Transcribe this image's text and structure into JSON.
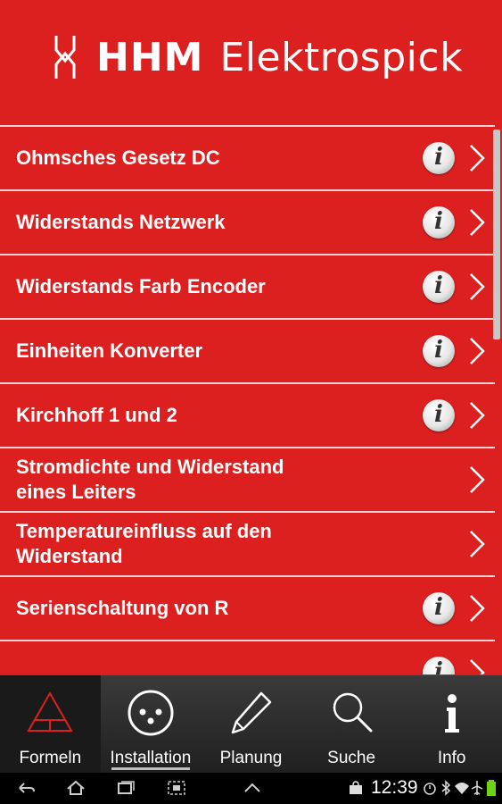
{
  "header": {
    "brand": "HHM",
    "app_name": "Elektrospick"
  },
  "list": {
    "items": [
      {
        "label": "Ohmsches Gesetz DC",
        "has_info": true
      },
      {
        "label": "Widerstands Netzwerk",
        "has_info": true
      },
      {
        "label": "Widerstands Farb Encoder",
        "has_info": true
      },
      {
        "label": "Einheiten Konverter",
        "has_info": true
      },
      {
        "label": "Kirchhoff 1 und 2",
        "has_info": true
      },
      {
        "label": "Stromdichte und Widerstand\neines Leiters",
        "has_info": false
      },
      {
        "label": "Temperatureinfluss auf den\nWiderstand",
        "has_info": false
      },
      {
        "label": "Serienschaltung von R",
        "has_info": true
      },
      {
        "label": "",
        "has_info": true
      }
    ],
    "info_glyph": "i"
  },
  "tabs": [
    {
      "label": "Formeln",
      "icon": "triangle-formula-icon",
      "selected": true
    },
    {
      "label": "Installation",
      "icon": "socket-icon",
      "selected": false
    },
    {
      "label": "Planung",
      "icon": "pencil-icon",
      "selected": false
    },
    {
      "label": "Suche",
      "icon": "search-icon",
      "selected": false
    },
    {
      "label": "Info",
      "icon": "info-icon",
      "selected": false
    }
  ],
  "status_bar": {
    "time": "12:39"
  },
  "colors": {
    "accent": "#dc2020",
    "tab_bar": "#2a2a2a",
    "selected_icon": "#dc2020"
  }
}
